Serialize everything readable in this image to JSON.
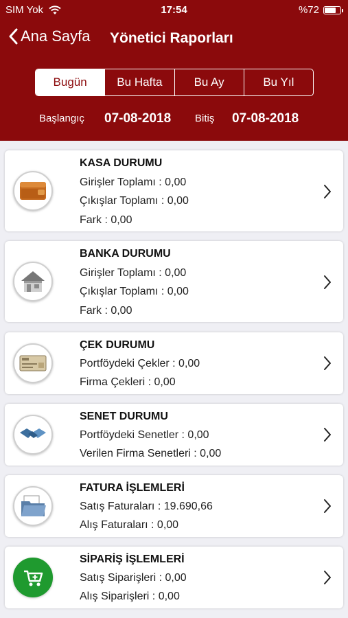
{
  "status_bar": {
    "carrier": "SIM Yok",
    "time": "17:54",
    "battery": "%72",
    "battery_level": 0.72
  },
  "nav": {
    "back_label": "Ana Sayfa",
    "title": "Yönetici Raporları"
  },
  "periods": {
    "items": [
      "Bugün",
      "Bu Hafta",
      "Bu Ay",
      "Bu Yıl"
    ],
    "selected": "Bugün"
  },
  "dates": {
    "start_label": "Başlangıç",
    "start": "07-08-2018",
    "end_label": "Bitiş",
    "end": "07-08-2018"
  },
  "cards": [
    {
      "icon": "wallet-icon",
      "title": "KASA DURUMU",
      "lines": [
        "Girişler Toplamı : 0,00",
        "Çıkışlar Toplamı : 0,00",
        "Fark : 0,00"
      ]
    },
    {
      "icon": "bank-icon",
      "title": "BANKA DURUMU",
      "lines": [
        "Girişler Toplamı : 0,00",
        "Çıkışlar Toplamı : 0,00",
        "Fark : 0,00"
      ]
    },
    {
      "icon": "check-icon",
      "title": "ÇEK DURUMU",
      "lines": [
        "Portföydeki Çekler : 0,00",
        "Firma Çekleri : 0,00"
      ]
    },
    {
      "icon": "handshake-icon",
      "title": "SENET DURUMU",
      "lines": [
        "Portföydeki Senetler : 0,00",
        "Verilen Firma Senetleri : 0,00"
      ]
    },
    {
      "icon": "folder-icon",
      "title": "FATURA İŞLEMLERİ",
      "lines": [
        "Satış Faturaları : 19.690,66",
        "Alış Faturaları  : 0,00"
      ]
    },
    {
      "icon": "cart-icon",
      "title": "SİPARİŞ İŞLEMLERİ",
      "lines": [
        "Satış Siparişleri : 0,00",
        "Alış Siparişleri  : 0,00"
      ]
    }
  ],
  "colors": {
    "brand": "#8b0a0c",
    "background": "#efeff4",
    "order_icon": "#1f9a2f"
  }
}
